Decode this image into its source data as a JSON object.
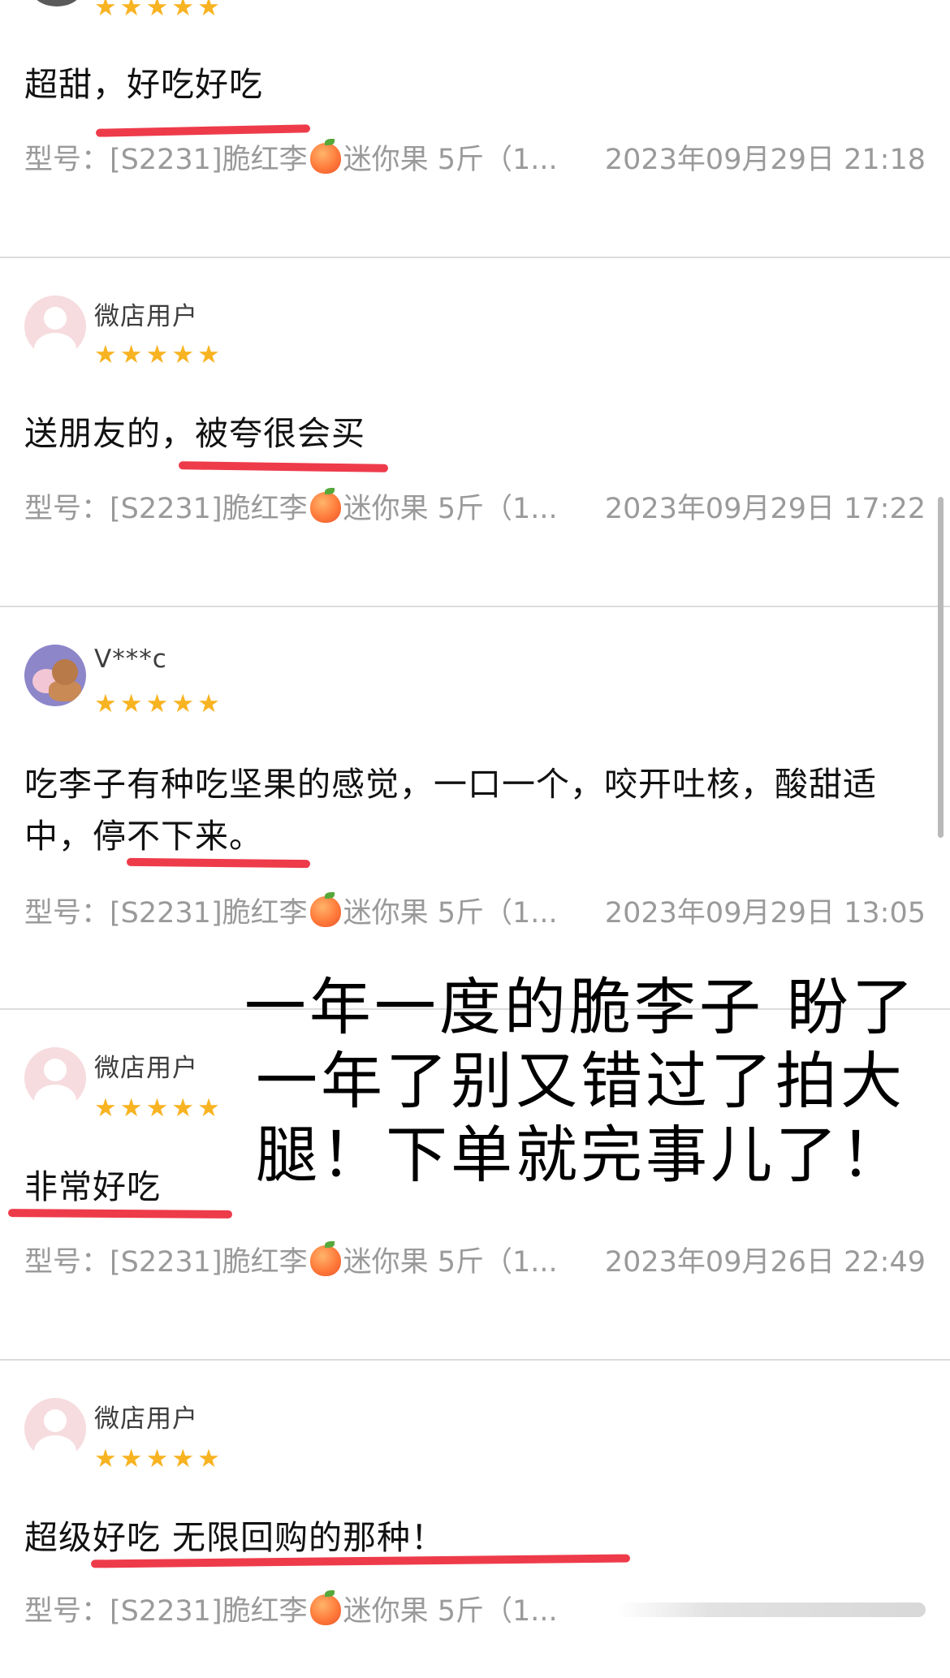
{
  "reviews": [
    {
      "username": "",
      "stars": "★★★★★",
      "comment": "超甜，好吃好吃",
      "model_label": "型号：[S2231]脆红李",
      "model_suffix": "迷你果 5斤（1...",
      "date": "2023年09月29日 21:18"
    },
    {
      "username": "微店用户",
      "stars": "★★★★★",
      "comment": "送朋友的，被夸很会买",
      "model_label": "型号：[S2231]脆红李",
      "model_suffix": "迷你果 5斤（1...",
      "date": "2023年09月29日 17:22"
    },
    {
      "username": "V***c",
      "stars": "★★★★★",
      "comment": "吃李子有种吃坚果的感觉，一口一个，咬开吐核，酸甜适中，停不下来。",
      "model_label": "型号：[S2231]脆红李",
      "model_suffix": "迷你果 5斤（1...",
      "date": "2023年09月29日 13:05"
    },
    {
      "username": "微店用户",
      "stars": "★★★★★",
      "comment": "非常好吃",
      "model_label": "型号：[S2231]脆红李",
      "model_suffix": "迷你果 5斤（1...",
      "date": "2023年09月26日 22:49"
    },
    {
      "username": "微店用户",
      "stars": "★★★★★",
      "comment": "超级好吃 无限回购的那种！",
      "model_label": "型号：[S2231]脆红李",
      "model_suffix": "迷你果 5斤（1...",
      "date": ""
    }
  ],
  "overlay": {
    "line1": "一年一度的脆李子 盼了",
    "line2": "一年了别又错过了拍大",
    "line3": "腿！下单就完事儿了！"
  },
  "colors": {
    "star": "#f8b322",
    "underline": "#ee3b4a",
    "meta_text": "#9a9a9a",
    "divider": "#dcdcdc"
  },
  "icons": {
    "product_emoji": "peach-icon",
    "default_avatar": "default-avatar-icon",
    "custom_avatar": "bear-bunny-avatar"
  }
}
